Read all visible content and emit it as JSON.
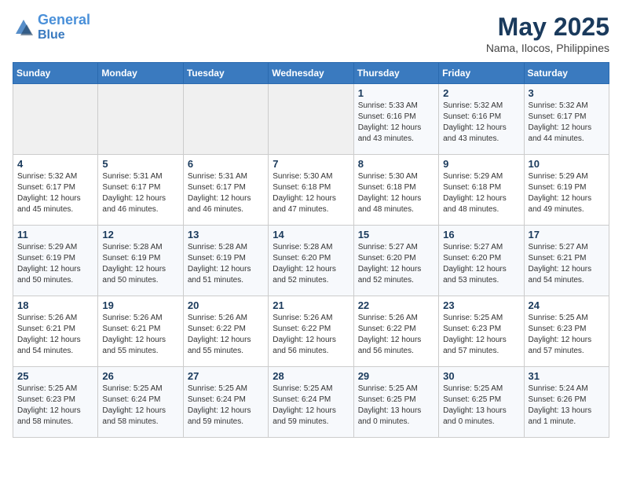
{
  "header": {
    "logo_line1": "General",
    "logo_line2": "Blue",
    "month": "May 2025",
    "location": "Nama, Ilocos, Philippines"
  },
  "weekdays": [
    "Sunday",
    "Monday",
    "Tuesday",
    "Wednesday",
    "Thursday",
    "Friday",
    "Saturday"
  ],
  "weeks": [
    [
      {
        "day": "",
        "info": ""
      },
      {
        "day": "",
        "info": ""
      },
      {
        "day": "",
        "info": ""
      },
      {
        "day": "",
        "info": ""
      },
      {
        "day": "1",
        "info": "Sunrise: 5:33 AM\nSunset: 6:16 PM\nDaylight: 12 hours\nand 43 minutes."
      },
      {
        "day": "2",
        "info": "Sunrise: 5:32 AM\nSunset: 6:16 PM\nDaylight: 12 hours\nand 43 minutes."
      },
      {
        "day": "3",
        "info": "Sunrise: 5:32 AM\nSunset: 6:17 PM\nDaylight: 12 hours\nand 44 minutes."
      }
    ],
    [
      {
        "day": "4",
        "info": "Sunrise: 5:32 AM\nSunset: 6:17 PM\nDaylight: 12 hours\nand 45 minutes."
      },
      {
        "day": "5",
        "info": "Sunrise: 5:31 AM\nSunset: 6:17 PM\nDaylight: 12 hours\nand 46 minutes."
      },
      {
        "day": "6",
        "info": "Sunrise: 5:31 AM\nSunset: 6:17 PM\nDaylight: 12 hours\nand 46 minutes."
      },
      {
        "day": "7",
        "info": "Sunrise: 5:30 AM\nSunset: 6:18 PM\nDaylight: 12 hours\nand 47 minutes."
      },
      {
        "day": "8",
        "info": "Sunrise: 5:30 AM\nSunset: 6:18 PM\nDaylight: 12 hours\nand 48 minutes."
      },
      {
        "day": "9",
        "info": "Sunrise: 5:29 AM\nSunset: 6:18 PM\nDaylight: 12 hours\nand 48 minutes."
      },
      {
        "day": "10",
        "info": "Sunrise: 5:29 AM\nSunset: 6:19 PM\nDaylight: 12 hours\nand 49 minutes."
      }
    ],
    [
      {
        "day": "11",
        "info": "Sunrise: 5:29 AM\nSunset: 6:19 PM\nDaylight: 12 hours\nand 50 minutes."
      },
      {
        "day": "12",
        "info": "Sunrise: 5:28 AM\nSunset: 6:19 PM\nDaylight: 12 hours\nand 50 minutes."
      },
      {
        "day": "13",
        "info": "Sunrise: 5:28 AM\nSunset: 6:19 PM\nDaylight: 12 hours\nand 51 minutes."
      },
      {
        "day": "14",
        "info": "Sunrise: 5:28 AM\nSunset: 6:20 PM\nDaylight: 12 hours\nand 52 minutes."
      },
      {
        "day": "15",
        "info": "Sunrise: 5:27 AM\nSunset: 6:20 PM\nDaylight: 12 hours\nand 52 minutes."
      },
      {
        "day": "16",
        "info": "Sunrise: 5:27 AM\nSunset: 6:20 PM\nDaylight: 12 hours\nand 53 minutes."
      },
      {
        "day": "17",
        "info": "Sunrise: 5:27 AM\nSunset: 6:21 PM\nDaylight: 12 hours\nand 54 minutes."
      }
    ],
    [
      {
        "day": "18",
        "info": "Sunrise: 5:26 AM\nSunset: 6:21 PM\nDaylight: 12 hours\nand 54 minutes."
      },
      {
        "day": "19",
        "info": "Sunrise: 5:26 AM\nSunset: 6:21 PM\nDaylight: 12 hours\nand 55 minutes."
      },
      {
        "day": "20",
        "info": "Sunrise: 5:26 AM\nSunset: 6:22 PM\nDaylight: 12 hours\nand 55 minutes."
      },
      {
        "day": "21",
        "info": "Sunrise: 5:26 AM\nSunset: 6:22 PM\nDaylight: 12 hours\nand 56 minutes."
      },
      {
        "day": "22",
        "info": "Sunrise: 5:26 AM\nSunset: 6:22 PM\nDaylight: 12 hours\nand 56 minutes."
      },
      {
        "day": "23",
        "info": "Sunrise: 5:25 AM\nSunset: 6:23 PM\nDaylight: 12 hours\nand 57 minutes."
      },
      {
        "day": "24",
        "info": "Sunrise: 5:25 AM\nSunset: 6:23 PM\nDaylight: 12 hours\nand 57 minutes."
      }
    ],
    [
      {
        "day": "25",
        "info": "Sunrise: 5:25 AM\nSunset: 6:23 PM\nDaylight: 12 hours\nand 58 minutes."
      },
      {
        "day": "26",
        "info": "Sunrise: 5:25 AM\nSunset: 6:24 PM\nDaylight: 12 hours\nand 58 minutes."
      },
      {
        "day": "27",
        "info": "Sunrise: 5:25 AM\nSunset: 6:24 PM\nDaylight: 12 hours\nand 59 minutes."
      },
      {
        "day": "28",
        "info": "Sunrise: 5:25 AM\nSunset: 6:24 PM\nDaylight: 12 hours\nand 59 minutes."
      },
      {
        "day": "29",
        "info": "Sunrise: 5:25 AM\nSunset: 6:25 PM\nDaylight: 13 hours\nand 0 minutes."
      },
      {
        "day": "30",
        "info": "Sunrise: 5:25 AM\nSunset: 6:25 PM\nDaylight: 13 hours\nand 0 minutes."
      },
      {
        "day": "31",
        "info": "Sunrise: 5:24 AM\nSunset: 6:26 PM\nDaylight: 13 hours\nand 1 minute."
      }
    ]
  ]
}
